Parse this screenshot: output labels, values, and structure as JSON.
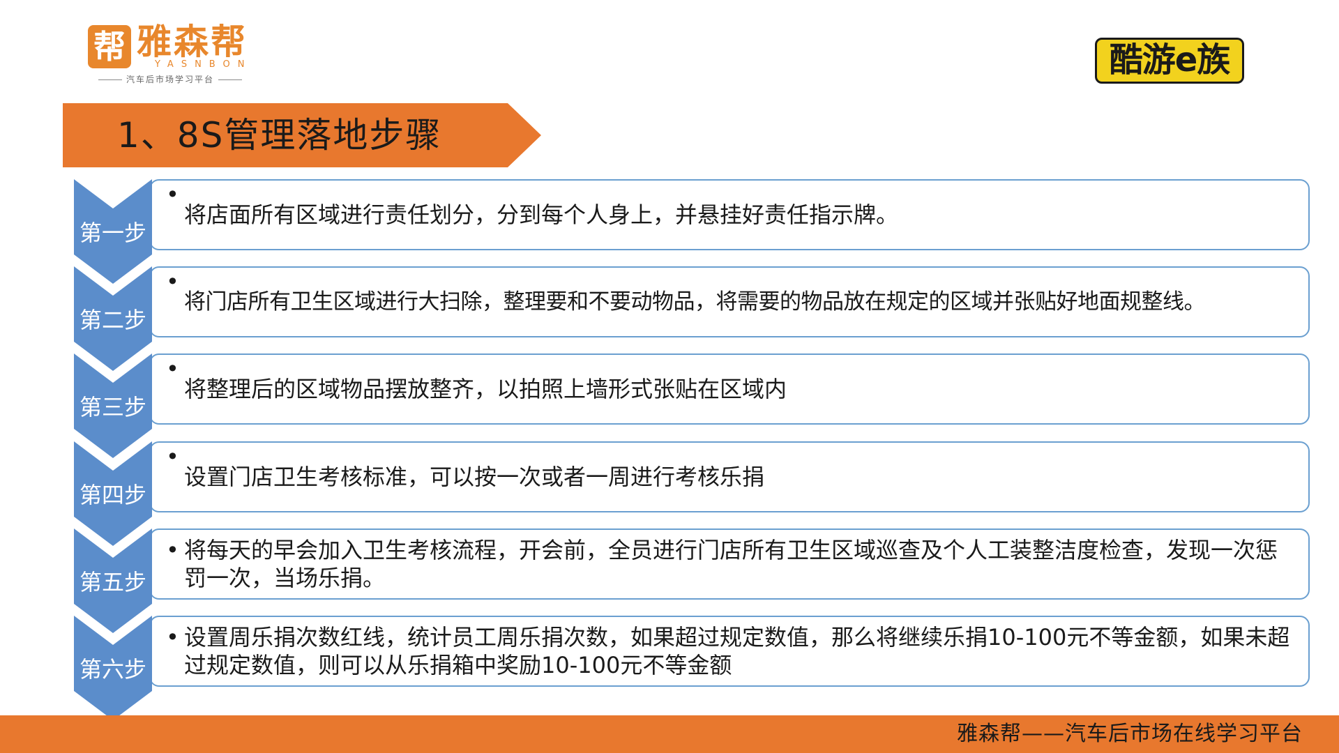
{
  "header": {
    "left_logo": {
      "mark": "帮",
      "name": "雅森帮",
      "latin": "YASNBON",
      "tagline": "汽车后市场学习平台"
    },
    "right_logo": {
      "text": "酷游e族"
    }
  },
  "title": "1、8S管理落地步骤",
  "steps": [
    {
      "label": "第一步",
      "text": "将店面所有区域进行责任划分，分到每个人身上，并悬挂好责任指示牌。"
    },
    {
      "label": "第二步",
      "text": "将门店所有卫生区域进行大扫除，整理要和不要动物品，将需要的物品放在规定的区域并张贴好地面规整线。"
    },
    {
      "label": "第三步",
      "text": "将整理后的区域物品摆放整齐，以拍照上墙形式张贴在区域内"
    },
    {
      "label": "第四步",
      "text": "设置门店卫生考核标准，可以按一次或者一周进行考核乐捐"
    },
    {
      "label": "第五步",
      "text": "将每天的早会加入卫生考核流程，开会前，全员进行门店所有卫生区域巡查及个人工装整洁度检查，发现一次惩罚一次，当场乐捐。"
    },
    {
      "label": "第六步",
      "text": "设置周乐捐次数红线，统计员工周乐捐次数，如果超过规定数值，那么将继续乐捐10-100元不等金额，如果未超过规定数值，则可以从乐捐箱中奖励10-100元不等金额"
    }
  ],
  "bullet": "•",
  "footer": {
    "text": "雅森帮——汽车后市场在线学习平台"
  },
  "colors": {
    "accent_orange": "#e8782e",
    "step_blue": "#5b8dcb",
    "box_border": "#6a9fd0"
  }
}
